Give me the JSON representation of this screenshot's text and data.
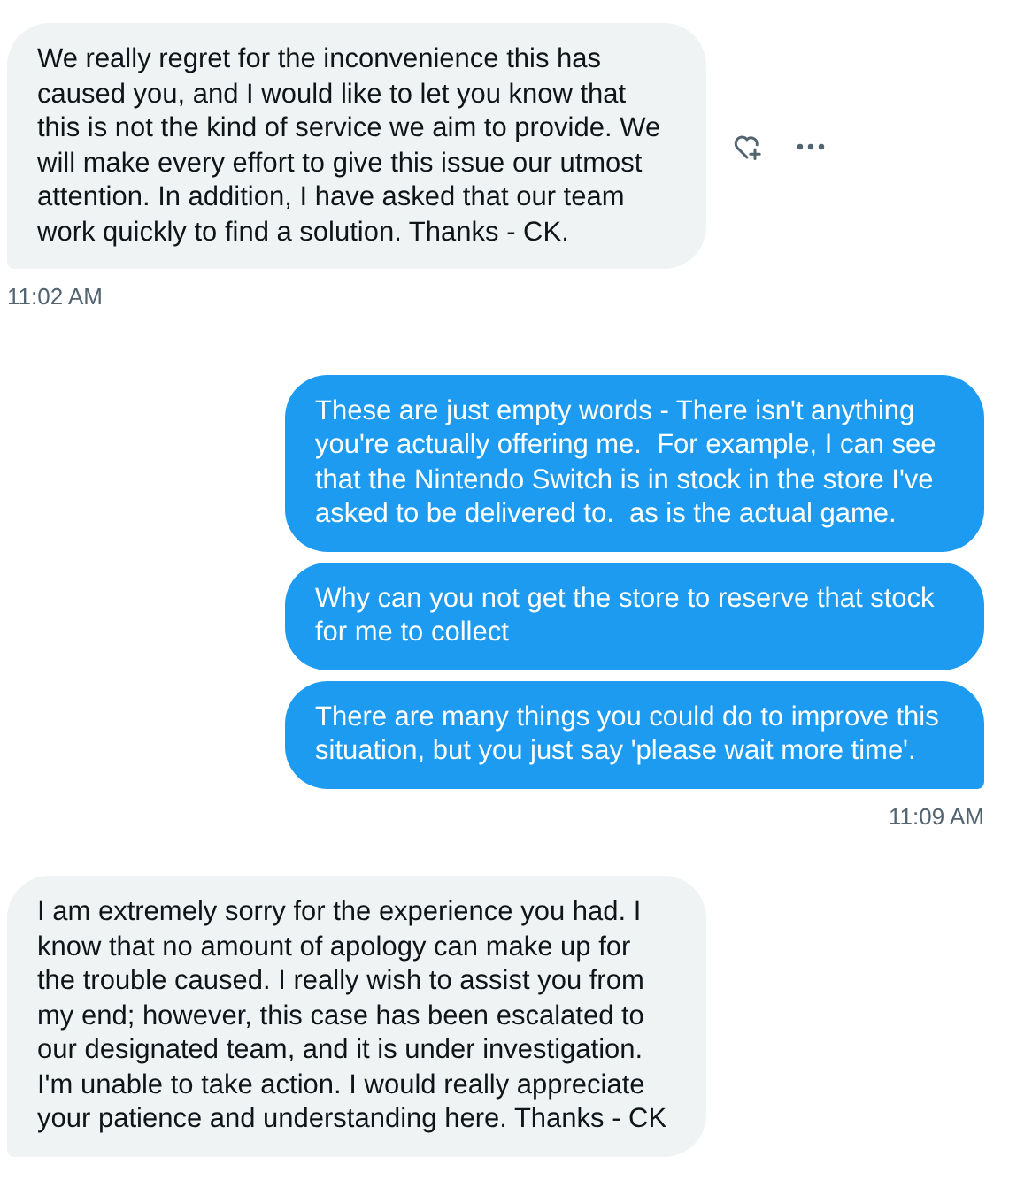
{
  "groups": [
    {
      "kind": "incoming",
      "time": "11:02 AM",
      "messages": [
        {
          "text": "We really regret for the inconvenience this has caused you, and I would like to let you know that this is not the kind of service we aim to provide. We will make every effort to give this issue our utmost attention. In addition, I have asked that our team work quickly to find a solution. Thanks - CK.",
          "hovered": true
        }
      ]
    },
    {
      "kind": "outgoing",
      "time": "11:09 AM",
      "messages": [
        {
          "text": "These are just empty words - There isn't anything you're actually offering me.  For example, I can see that the Nintendo Switch is in stock in the store I've asked to be delivered to.  as is the actual game.",
          "hovered": false
        },
        {
          "text": "Why can you not get the store to reserve that stock for me to collect",
          "hovered": false
        },
        {
          "text": "There are many things you could do to improve this situation, but you just say 'please wait more time'.",
          "hovered": false
        }
      ]
    },
    {
      "kind": "incoming",
      "messages": [
        {
          "text": "I am extremely sorry for the experience you had. I know that no amount of apology can make up for the trouble caused. I really wish to assist you from my end; however, this case has been escalated to our designated team, and it is under investigation. I'm unable to take action. I would really appreciate your patience and understanding here. Thanks - CK",
          "hovered": false
        }
      ]
    }
  ]
}
